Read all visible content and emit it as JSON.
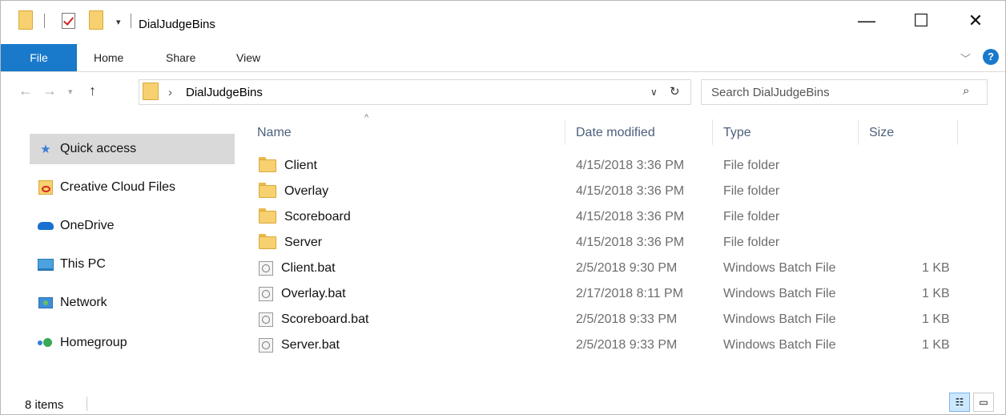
{
  "window": {
    "title": "DialJudgeBins",
    "controls": {
      "minimize": "—",
      "maximize": "☐",
      "close": "✕"
    }
  },
  "ribbon": {
    "tabs": [
      {
        "label": "File"
      },
      {
        "label": "Home"
      },
      {
        "label": "Share"
      },
      {
        "label": "View"
      }
    ],
    "help": "?"
  },
  "address": {
    "breadcrumb": [
      "DialJudgeBins"
    ],
    "search_placeholder": "Search DialJudgeBins"
  },
  "nav_pane": {
    "items": [
      {
        "label": "Quick access",
        "icon": "star-icon",
        "selected": true
      },
      {
        "label": "Creative Cloud Files",
        "icon": "creative-cloud-icon"
      },
      {
        "label": "OneDrive",
        "icon": "onedrive-icon"
      },
      {
        "label": "This PC",
        "icon": "this-pc-icon"
      },
      {
        "label": "Network",
        "icon": "network-icon"
      },
      {
        "label": "Homegroup",
        "icon": "homegroup-icon"
      }
    ]
  },
  "file_list": {
    "columns": {
      "name": "Name",
      "date": "Date modified",
      "type": "Type",
      "size": "Size"
    },
    "rows": [
      {
        "name": "Client",
        "date": "4/15/2018 3:36 PM",
        "type": "File folder",
        "size": "",
        "kind": "folder"
      },
      {
        "name": "Overlay",
        "date": "4/15/2018 3:36 PM",
        "type": "File folder",
        "size": "",
        "kind": "folder"
      },
      {
        "name": "Scoreboard",
        "date": "4/15/2018 3:36 PM",
        "type": "File folder",
        "size": "",
        "kind": "folder"
      },
      {
        "name": "Server",
        "date": "4/15/2018 3:36 PM",
        "type": "File folder",
        "size": "",
        "kind": "folder"
      },
      {
        "name": "Client.bat",
        "date": "2/5/2018 9:30 PM",
        "type": "Windows Batch File",
        "size": "1 KB",
        "kind": "batch"
      },
      {
        "name": "Overlay.bat",
        "date": "2/17/2018 8:11 PM",
        "type": "Windows Batch File",
        "size": "1 KB",
        "kind": "batch"
      },
      {
        "name": "Scoreboard.bat",
        "date": "2/5/2018 9:33 PM",
        "type": "Windows Batch File",
        "size": "1 KB",
        "kind": "batch"
      },
      {
        "name": "Server.bat",
        "date": "2/5/2018 9:33 PM",
        "type": "Windows Batch File",
        "size": "1 KB",
        "kind": "batch"
      }
    ]
  },
  "status_bar": {
    "item_count": "8 items"
  },
  "colors": {
    "file_tab": "#1979ca",
    "header_text": "#4c607a",
    "selected_nav": "#d9d9d9"
  }
}
